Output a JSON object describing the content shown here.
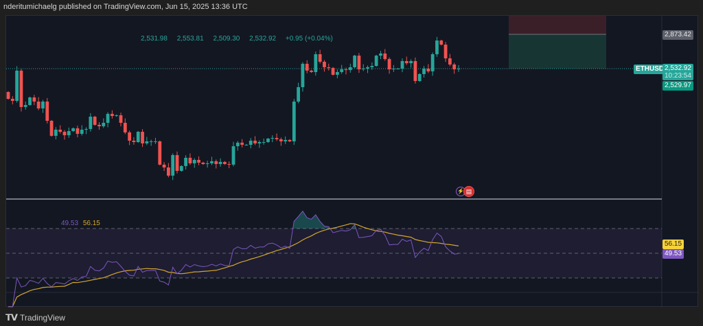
{
  "header": {
    "publisher_line": "nderitumichaelg published on TradingView.com, Jun 15, 2025 13:36 UTC"
  },
  "ohlc": {
    "open": "2,531.98",
    "high": "2,553.81",
    "low": "2,509.30",
    "close": "2,532.92",
    "change": "+0.95 (+0.04%)"
  },
  "price_scale": {
    "target_label": "2,873.42",
    "symbol": "ETHUSD",
    "last_price": "2,532.92",
    "countdown": "10:23:54",
    "second_price": "2,529.97"
  },
  "rsi": {
    "rsi_value": "49.53",
    "ma_value": "56.15",
    "levels": [
      70,
      50,
      30
    ]
  },
  "colors": {
    "up": "#26a69a",
    "down": "#ef5350",
    "rsi": "#7e57c2",
    "rsi_ma": "#d4a72c",
    "target_tag": "#787b86",
    "ma_tag": "#f7d33a"
  },
  "branding": {
    "name": "TradingView"
  },
  "chart_data": {
    "type": "candlestick",
    "symbol": "ETHUSD",
    "first_open": 2301,
    "closes": [
      2233,
      2213,
      2513,
      2152,
      2172,
      2247,
      2206,
      2138,
      2206,
      2015,
      1866,
      1927,
      1906,
      1872,
      1913,
      1941,
      1886,
      1927,
      1934,
      2056,
      1975,
      1961,
      1995,
      2084,
      2063,
      2070,
      1995,
      1900,
      1818,
      1804,
      1906,
      1791,
      1811,
      1811,
      1811,
      1580,
      1552,
      1471,
      1675,
      1518,
      1566,
      1648,
      1593,
      1627,
      1600,
      1586,
      1593,
      1614,
      1586,
      1607,
      1586,
      1580,
      1763,
      1798,
      1777,
      1777,
      1818,
      1791,
      1804,
      1804,
      1838,
      1845,
      1832,
      1811,
      1825,
      1811,
      2206,
      2349,
      2581,
      2513,
      2499,
      2676,
      2601,
      2547,
      2540,
      2472,
      2499,
      2526,
      2519,
      2547,
      2662,
      2526,
      2533,
      2547,
      2560,
      2662,
      2683,
      2628,
      2526,
      2533,
      2533,
      2608,
      2587,
      2608,
      2410,
      2479,
      2533,
      2506,
      2676,
      2812,
      2771,
      2635,
      2574,
      2526,
      2533
    ],
    "position": {
      "entry": 2532.92,
      "target": 2873.42,
      "stop_upper": 3070
    }
  }
}
